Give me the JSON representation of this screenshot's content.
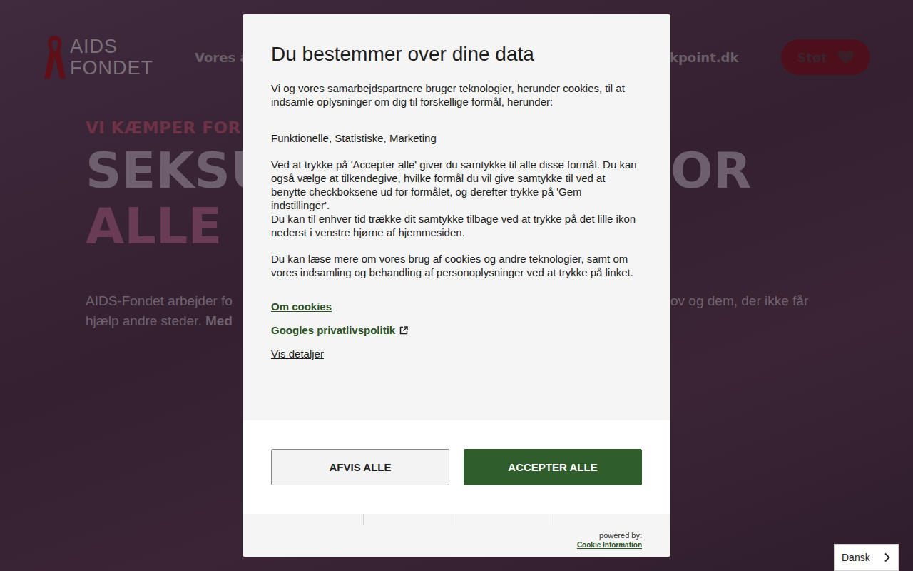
{
  "page": {
    "header": {
      "logo": {
        "line1": "AIDS",
        "line2": "FONDET"
      },
      "nav_left": "Vores ar",
      "nav_right": "kpoint.dk",
      "donate_button": "Støt"
    },
    "hero": {
      "eyebrow": "VI KÆMPER FOR",
      "title_lines": [
        {
          "left": "SEKSU",
          "right": "OR"
        },
        {
          "left": "ALLE",
          "right": ""
        }
      ],
      "paragraph_lines": [
        {
          "left": "AIDS-Fondet arbejder fo",
          "bold": "",
          "right": "ov og dem, der ikke får"
        },
        {
          "left": "hjælp andre steder. ",
          "bold": "Med",
          "right": ""
        }
      ]
    }
  },
  "modal": {
    "title": "Du bestemmer over dine data",
    "intro": "Vi og vores samarbejdspartnere bruger teknologier, herunder cookies, til at indsamle oplysninger om dig til forskellige formål, herunder:",
    "purposes": "Funktionelle, Statistiske, Marketing",
    "consent_lines": [
      "Ved at trykke på 'Accepter alle' giver du samtykke til alle disse formål. Du kan også vælge at tilkendegive, hvilke formål du vil give samtykke til ved at benytte checkboksene ud for formålet, og derefter trykke på 'Gem indstillinger'.",
      "Du kan til enhver tid trække dit samtykke tilbage ved at trykke på det lille ikon nederst i venstre hjørne af hjemmesiden."
    ],
    "read_more": "Du kan læse mere om vores brug af cookies og andre teknologier, samt om vores indsamling og behandling af personoplysninger ved at trykke på linket.",
    "links": [
      {
        "label": "Om cookies",
        "kind": "green",
        "external": false
      },
      {
        "label": "Googles privatlivspolitik",
        "kind": "green",
        "external": true
      },
      {
        "label": "Vis detaljer",
        "kind": "plain",
        "external": false
      }
    ],
    "buttons": [
      {
        "label": "AFVIS ALLE",
        "kind": "secondary"
      },
      {
        "label": "ACCEPTER ALLE",
        "kind": "primary"
      }
    ],
    "powered_by": "powered by:",
    "brand": "Cookie Information"
  },
  "language_selector": {
    "value": "Dansk"
  }
}
